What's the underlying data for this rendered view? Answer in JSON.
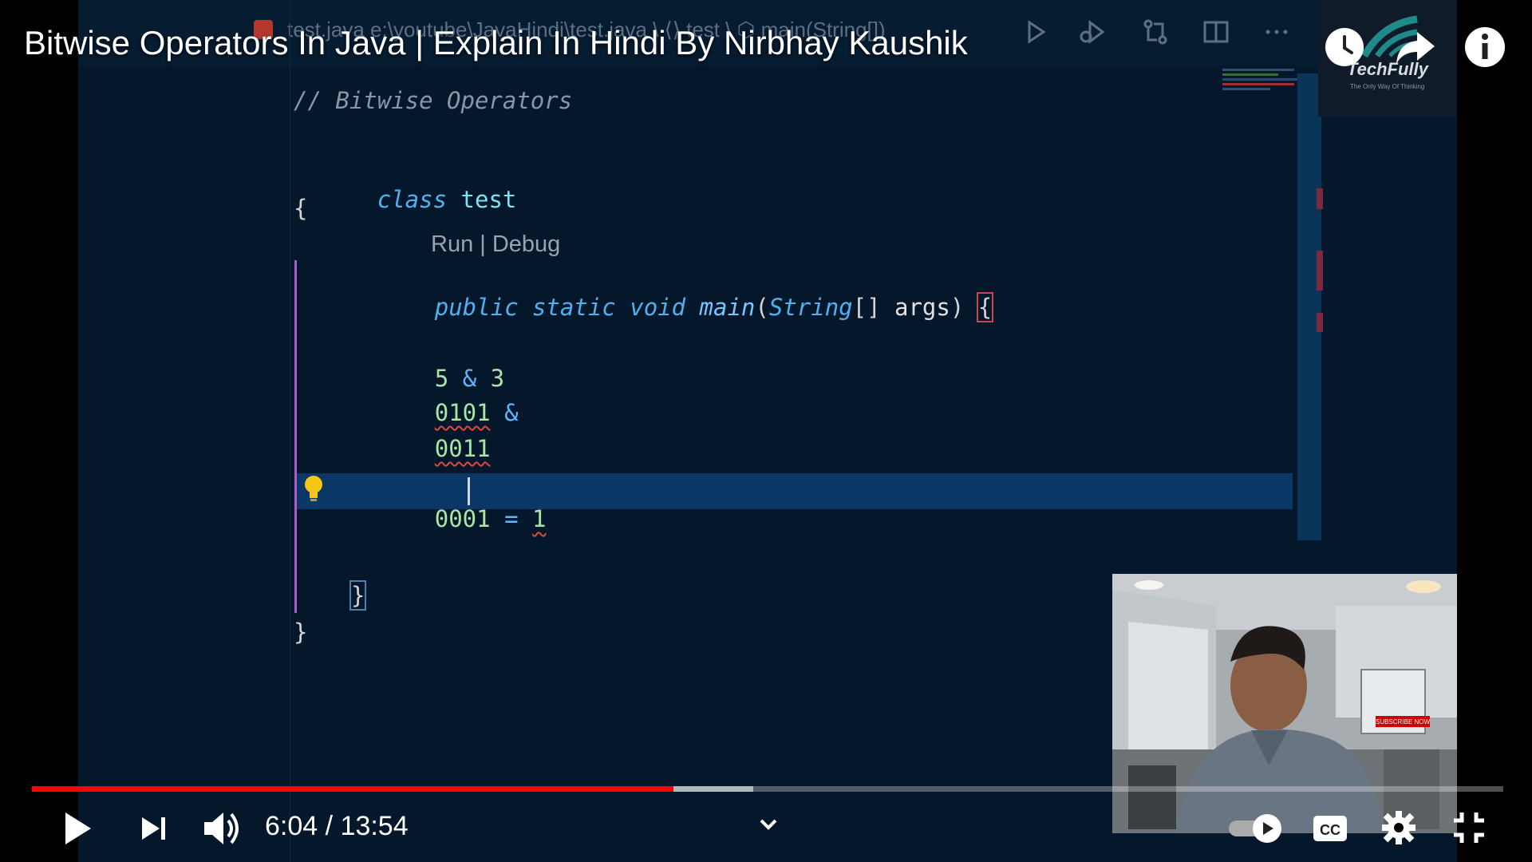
{
  "video": {
    "title": "Bitwise Operators In Java | Explain In Hindi By Nirbhay Kaushik",
    "current_time": "6:04",
    "separator": " / ",
    "duration": "13:54",
    "progress_played": 0.436,
    "progress_buffered": 0.49
  },
  "editor": {
    "tab_title": "test.java  e:\\youtube\\JavaHindi\\test.java \\ ⟨⟩ test \\ ⬡ main(String[])",
    "comment": "// Bitwise Operators",
    "kw_class": "class",
    "class_name": "test",
    "open_brace": "{",
    "code_lens": "Run | Debug",
    "kw_public": "public",
    "kw_static": "static",
    "kw_void": "void",
    "fn_main": "main",
    "paren_open": "(",
    "type_string": "String",
    "brackets": "[]",
    "args": "args",
    "paren_close": ")",
    "method_brace": "{",
    "line1_a": "5",
    "line1_op": "&",
    "line1_b": "3",
    "line2_a": "0101",
    "line2_op": "&",
    "line3_a": "0011",
    "line4_a": "0001",
    "line4_eq": "=",
    "line4_b": "1",
    "method_close": "}",
    "class_close": "}"
  },
  "channel": {
    "logo_name": "TechFully",
    "logo_tagline": "The Only Way Of Thinking",
    "subscribe_label": "SUBSCRIBE NOW"
  },
  "colors": {
    "progress": "#ff0000",
    "editor_bg": "#04172b",
    "highlight_line": "#0b3766"
  },
  "icons": [
    "clock-icon",
    "share-icon",
    "info-icon",
    "play-icon",
    "next-icon",
    "volume-icon",
    "chevron-down-icon",
    "autoplay-toggle",
    "cc-icon",
    "settings-icon",
    "exit-fullscreen-icon"
  ]
}
